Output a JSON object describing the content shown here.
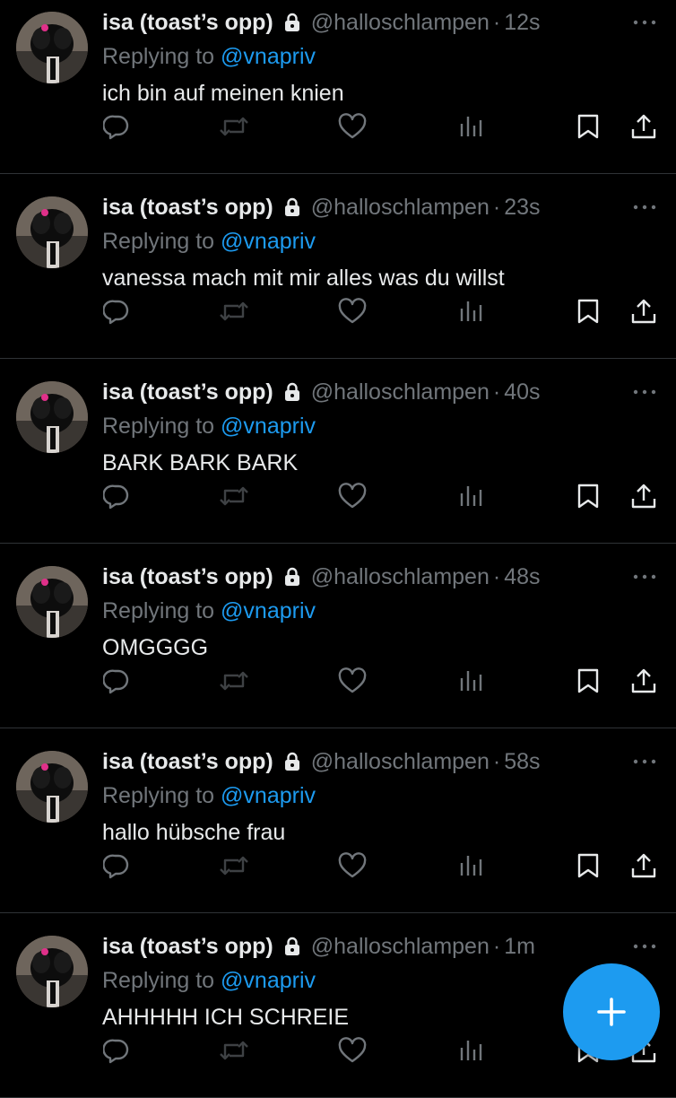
{
  "colors": {
    "background": "#000000",
    "text_primary": "#e7e9ea",
    "text_secondary": "#71767b",
    "accent": "#1d9bf0",
    "divider": "#2f3336"
  },
  "tweets": [
    {
      "display_name": "isa (toast’s opp)",
      "handle": "@halloschlampen",
      "separator": "·",
      "time": "12s",
      "replying_prefix": "Replying to ",
      "replying_to": "@vnapriv",
      "text": "ich bin auf meinen knien"
    },
    {
      "display_name": "isa (toast’s opp)",
      "handle": "@halloschlampen",
      "separator": "·",
      "time": "23s",
      "replying_prefix": "Replying to ",
      "replying_to": "@vnapriv",
      "text": "vanessa mach mit mir alles was du willst"
    },
    {
      "display_name": "isa (toast’s opp)",
      "handle": "@halloschlampen",
      "separator": "·",
      "time": "40s",
      "replying_prefix": "Replying to ",
      "replying_to": "@vnapriv",
      "text": "BARK BARK BARK"
    },
    {
      "display_name": "isa (toast’s opp)",
      "handle": "@halloschlampen",
      "separator": "·",
      "time": "48s",
      "replying_prefix": "Replying to ",
      "replying_to": "@vnapriv",
      "text": "OMGGGG"
    },
    {
      "display_name": "isa (toast’s opp)",
      "handle": "@halloschlampen",
      "separator": "·",
      "time": "58s",
      "replying_prefix": "Replying to ",
      "replying_to": "@vnapriv",
      "text": "hallo hübsche frau"
    },
    {
      "display_name": "isa (toast’s opp)",
      "handle": "@halloschlampen",
      "separator": "·",
      "time": "1m",
      "replying_prefix": "Replying to ",
      "replying_to": "@vnapriv",
      "text": "AHHHHH ICH SCHREIE"
    }
  ],
  "icons": {
    "lock": "lock-icon",
    "more": "more-icon",
    "reply": "reply-icon",
    "retweet": "retweet-icon",
    "like": "heart-icon",
    "views": "views-icon",
    "bookmark": "bookmark-icon",
    "share": "share-icon",
    "compose": "plus-icon"
  }
}
